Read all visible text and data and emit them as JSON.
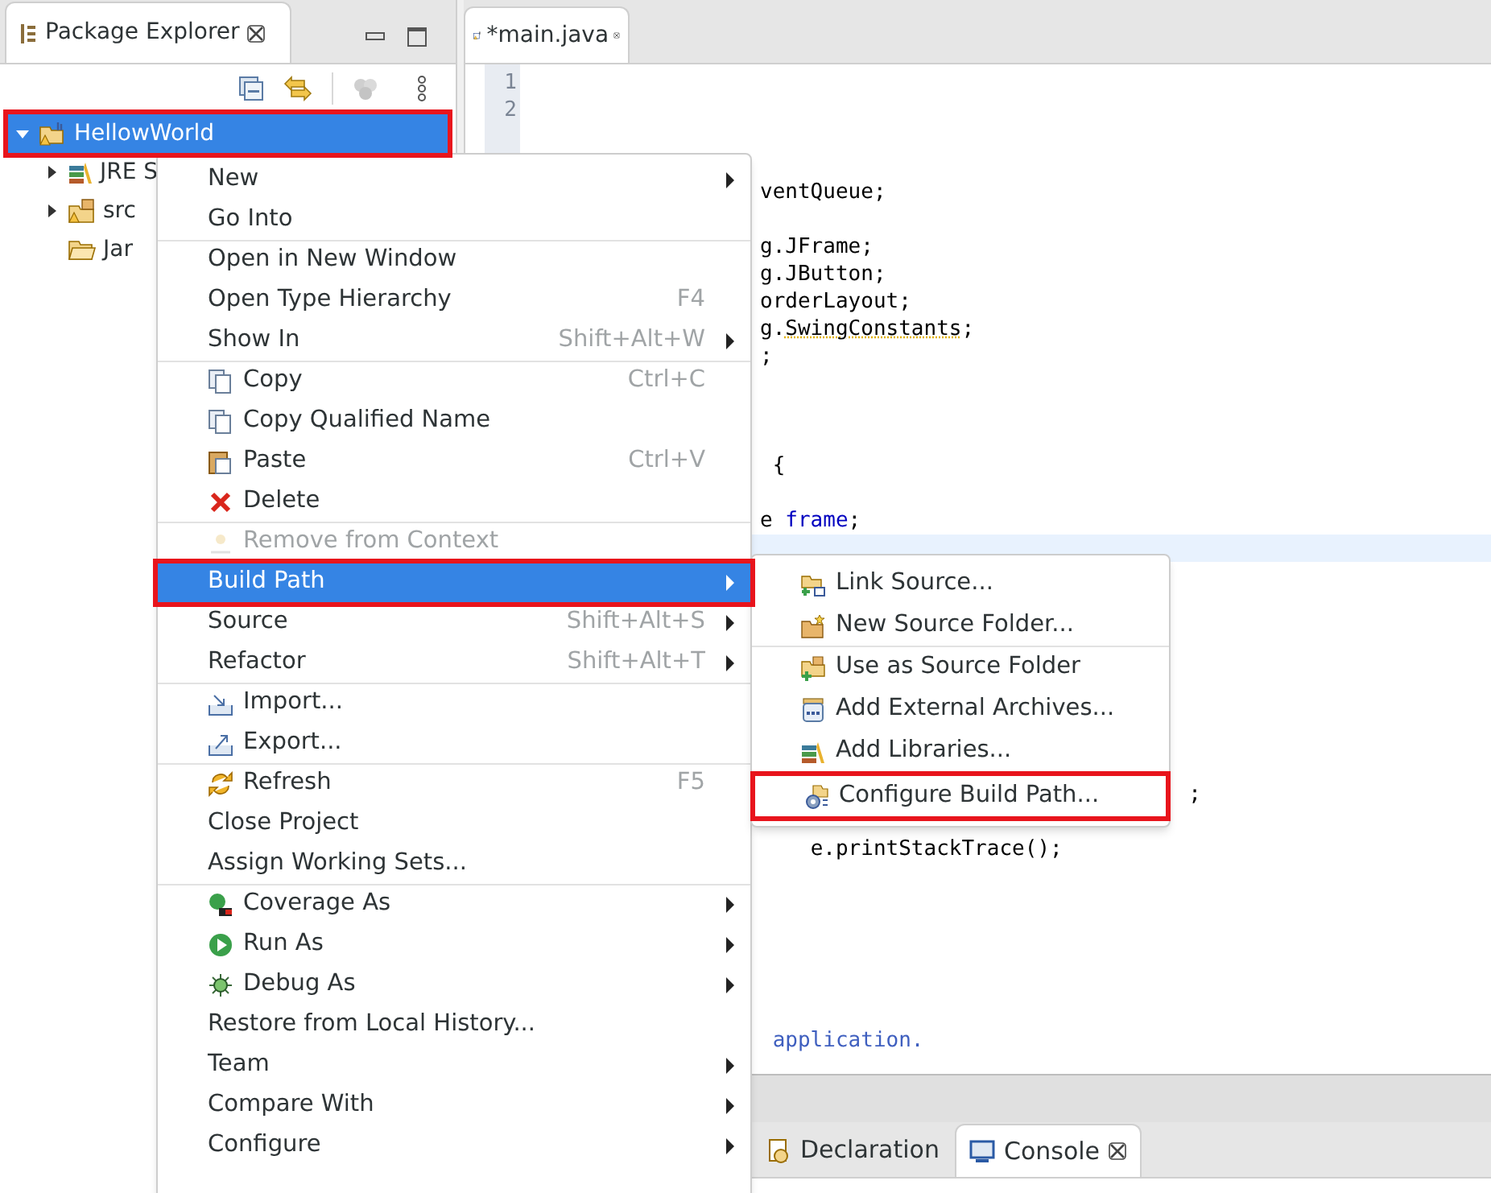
{
  "package_explorer": {
    "title": "Package Explorer",
    "tree": [
      {
        "label": "HellowWorld",
        "kind": "project",
        "selected": true,
        "expanded": true,
        "annotated": true,
        "children": [
          {
            "label": "JRE S",
            "kind": "library",
            "selected": false,
            "expanded": false,
            "annotated": false
          },
          {
            "label": "src",
            "kind": "package",
            "selected": false,
            "expanded": false,
            "annotated": false
          },
          {
            "label": "Jar",
            "kind": "folder",
            "selected": false,
            "annotated": false
          }
        ]
      }
    ]
  },
  "editor": {
    "tab": {
      "title": "*main.java",
      "selected": true
    },
    "line_numbers": [
      "1",
      "2"
    ],
    "lines": [
      {
        "current": false
      },
      {
        "current": false
      },
      {
        "current": false
      },
      {
        "current": false
      },
      {
        "current": false,
        "parts": [
          {
            "text": "ventQueue;",
            "kind": "plain"
          }
        ]
      },
      {
        "current": false
      },
      {
        "current": false,
        "parts": [
          {
            "text": "g.JFrame;",
            "kind": "plain"
          }
        ]
      },
      {
        "current": false,
        "parts": [
          {
            "text": "g.JButton;",
            "kind": "plain"
          }
        ]
      },
      {
        "current": false,
        "parts": [
          {
            "text": "orderLayout;",
            "kind": "plain"
          }
        ]
      },
      {
        "current": false,
        "parts": [
          {
            "text": "g.",
            "kind": "plain"
          },
          {
            "text": "SwingConstants",
            "kind": "warning"
          },
          {
            "text": ";",
            "kind": "plain"
          }
        ]
      },
      {
        "current": false,
        "parts": [
          {
            "text": ";",
            "kind": "plain"
          }
        ]
      },
      {
        "current": false
      },
      {
        "current": false
      },
      {
        "current": false
      },
      {
        "current": false,
        "parts": [
          {
            "text": " {",
            "kind": "plain"
          }
        ]
      },
      {
        "current": false
      },
      {
        "current": false,
        "parts": [
          {
            "text": "e ",
            "kind": "plain"
          },
          {
            "text": "frame",
            "kind": "field"
          },
          {
            "text": ";",
            "kind": "plain"
          }
        ]
      },
      {
        "current": true
      },
      {
        "current": false
      },
      {
        "current": false
      },
      {
        "current": false
      },
      {
        "current": false
      },
      {
        "current": false
      },
      {
        "current": false
      },
      {
        "current": false
      },
      {
        "current": false
      },
      {
        "current": false,
        "parts": [
          {
            "text": "                                  ;",
            "kind": "plain"
          }
        ]
      },
      {
        "current": false
      },
      {
        "current": false,
        "parts": [
          {
            "text": "    e.printStackTrace();",
            "kind": "plain"
          }
        ]
      },
      {
        "current": false
      },
      {
        "current": false
      },
      {
        "current": false
      },
      {
        "current": false
      },
      {
        "current": false
      },
      {
        "current": false
      },
      {
        "current": false,
        "parts": [
          {
            "text": " application.",
            "kind": "comment"
          }
        ]
      }
    ]
  },
  "bottom_panel": {
    "tabs": [
      {
        "label": "Declaration",
        "kind": "declaration",
        "selected": false,
        "closable": false
      },
      {
        "label": "Console",
        "kind": "console",
        "selected": true,
        "closable": true
      }
    ]
  },
  "context_menu": {
    "items": [
      {
        "label": "New",
        "kind": "plain",
        "submenu": true,
        "separator_before": false,
        "disabled": false,
        "selected": false,
        "annotated": false
      },
      {
        "label": "Go Into",
        "kind": "plain",
        "submenu": false,
        "separator_before": false,
        "disabled": false,
        "selected": false,
        "annotated": false
      },
      {
        "label": "Open in New Window",
        "kind": "plain",
        "submenu": false,
        "separator_before": true,
        "disabled": false,
        "selected": false,
        "annotated": false
      },
      {
        "label": "Open Type Hierarchy",
        "kind": "plain",
        "shortcut": "F4",
        "submenu": false,
        "separator_before": false,
        "disabled": false,
        "selected": false,
        "annotated": false
      },
      {
        "label": "Show In",
        "kind": "plain",
        "shortcut": "Shift+Alt+W",
        "submenu": true,
        "separator_before": false,
        "disabled": false,
        "selected": false,
        "annotated": false
      },
      {
        "label": "Copy",
        "kind": "copy",
        "shortcut": "Ctrl+C",
        "submenu": false,
        "separator_before": true,
        "disabled": false,
        "selected": false,
        "annotated": false
      },
      {
        "label": "Copy Qualified Name",
        "kind": "copy",
        "submenu": false,
        "separator_before": false,
        "disabled": false,
        "selected": false,
        "annotated": false
      },
      {
        "label": "Paste",
        "kind": "paste",
        "shortcut": "Ctrl+V",
        "submenu": false,
        "separator_before": false,
        "disabled": false,
        "selected": false,
        "annotated": false
      },
      {
        "label": "Delete",
        "kind": "delete",
        "submenu": false,
        "separator_before": false,
        "disabled": false,
        "selected": false,
        "annotated": false
      },
      {
        "label": "Remove from Context",
        "kind": "remove",
        "submenu": false,
        "separator_before": true,
        "disabled": true,
        "selected": false,
        "annotated": false
      },
      {
        "label": "Build Path",
        "kind": "plain",
        "submenu": true,
        "separator_before": false,
        "disabled": false,
        "selected": true,
        "annotated": true
      },
      {
        "label": "Source",
        "kind": "plain",
        "shortcut": "Shift+Alt+S",
        "submenu": true,
        "separator_before": false,
        "disabled": false,
        "selected": false,
        "annotated": false
      },
      {
        "label": "Refactor",
        "kind": "plain",
        "shortcut": "Shift+Alt+T",
        "submenu": true,
        "separator_before": false,
        "disabled": false,
        "selected": false,
        "annotated": false
      },
      {
        "label": "Import...",
        "kind": "import",
        "submenu": false,
        "separator_before": true,
        "disabled": false,
        "selected": false,
        "annotated": false
      },
      {
        "label": "Export...",
        "kind": "export",
        "submenu": false,
        "separator_before": false,
        "disabled": false,
        "selected": false,
        "annotated": false
      },
      {
        "label": "Refresh",
        "kind": "refresh",
        "shortcut": "F5",
        "submenu": false,
        "separator_before": true,
        "disabled": false,
        "selected": false,
        "annotated": false
      },
      {
        "label": "Close Project",
        "kind": "plain",
        "submenu": false,
        "separator_before": false,
        "disabled": false,
        "selected": false,
        "annotated": false
      },
      {
        "label": "Assign Working Sets...",
        "kind": "plain",
        "submenu": false,
        "separator_before": false,
        "disabled": false,
        "selected": false,
        "annotated": false
      },
      {
        "label": "Coverage As",
        "kind": "coverage",
        "submenu": true,
        "separator_before": true,
        "disabled": false,
        "selected": false,
        "annotated": false
      },
      {
        "label": "Run As",
        "kind": "run",
        "submenu": true,
        "separator_before": false,
        "disabled": false,
        "selected": false,
        "annotated": false
      },
      {
        "label": "Debug As",
        "kind": "debug",
        "submenu": true,
        "separator_before": false,
        "disabled": false,
        "selected": false,
        "annotated": false
      },
      {
        "label": "Restore from Local History...",
        "kind": "plain",
        "submenu": false,
        "separator_before": false,
        "disabled": false,
        "selected": false,
        "annotated": false
      },
      {
        "label": "Team",
        "kind": "plain",
        "submenu": true,
        "separator_before": false,
        "disabled": false,
        "selected": false,
        "annotated": false
      },
      {
        "label": "Compare With",
        "kind": "plain",
        "submenu": true,
        "separator_before": false,
        "disabled": false,
        "selected": false,
        "annotated": false
      },
      {
        "label": "Configure",
        "kind": "plain",
        "submenu": true,
        "separator_before": false,
        "disabled": false,
        "selected": false,
        "annotated": false
      }
    ]
  },
  "build_path_submenu": {
    "items": [
      {
        "label": "Link Source...",
        "kind": "link",
        "separator_before": false,
        "annotated": false
      },
      {
        "label": "New Source Folder...",
        "kind": "newfolder",
        "separator_before": false,
        "annotated": false
      },
      {
        "label": "Use as Source Folder",
        "kind": "usefolder",
        "separator_before": true,
        "annotated": false
      },
      {
        "label": "Add External Archives...",
        "kind": "jar",
        "separator_before": false,
        "annotated": false
      },
      {
        "label": "Add Libraries...",
        "kind": "library",
        "separator_before": false,
        "annotated": false
      },
      {
        "label": "Configure Build Path...",
        "kind": "configure",
        "separator_before": false,
        "annotated": true
      }
    ]
  }
}
